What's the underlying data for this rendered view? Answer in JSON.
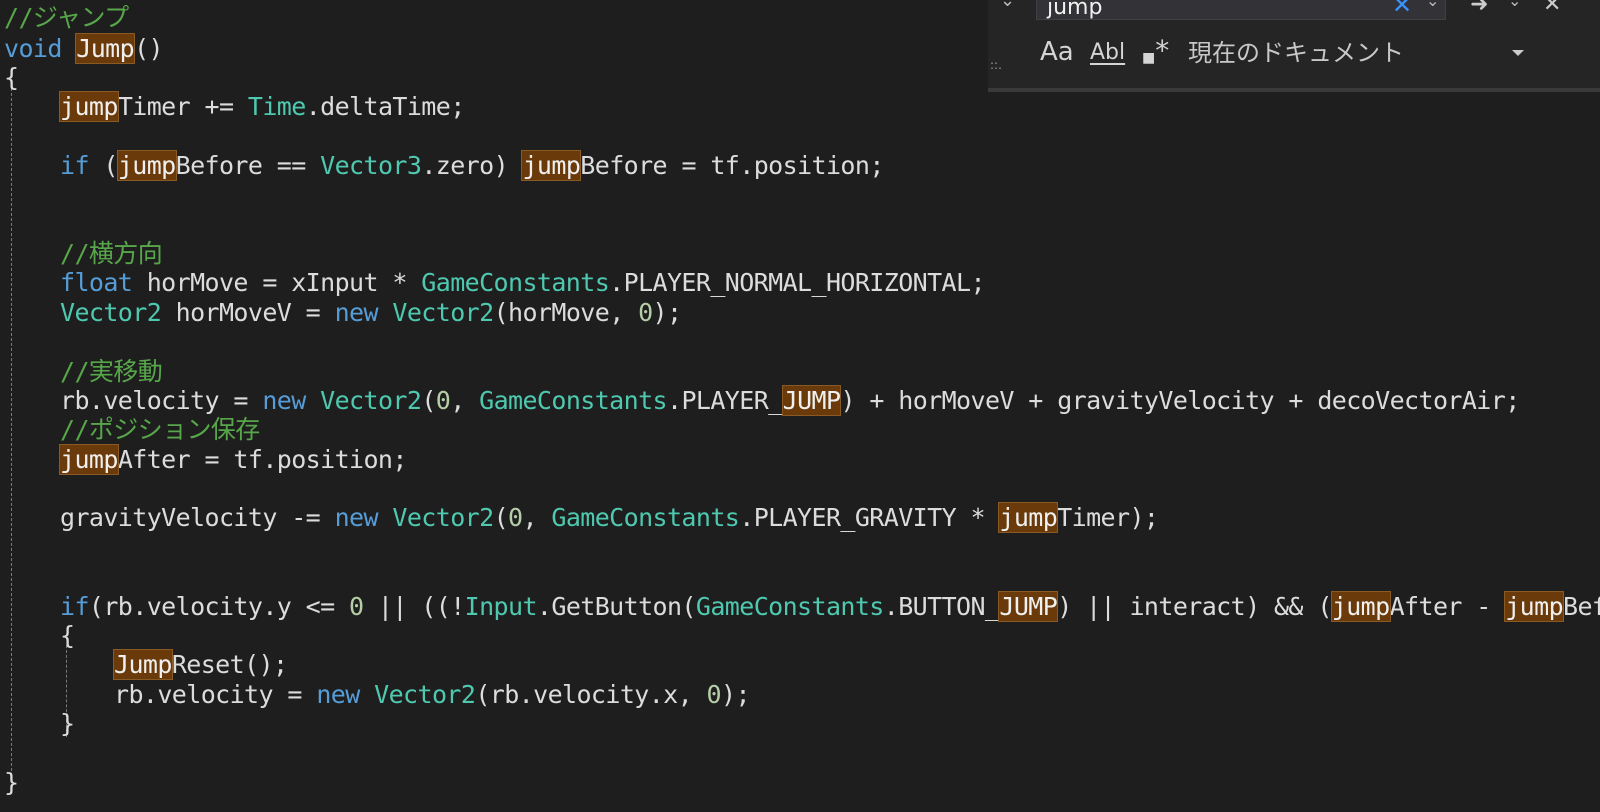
{
  "colors": {
    "background": "#1e1e1e",
    "comment": "#57a64a",
    "keyword": "#569cd6",
    "type": "#4ec9b0",
    "number": "#b5cea8",
    "identifier": "#dcdcdc",
    "highlight": "#6b3a0a"
  },
  "find_widget": {
    "search_value": "jump",
    "match_case_label": "Aa",
    "whole_word_label": "Abl",
    "regex_label": "*",
    "scope_label": "現在のドキュメント",
    "icons": [
      "collapse-chevron-icon",
      "clear-search-icon",
      "find-next-icon",
      "close-icon",
      "match-case-icon",
      "whole-word-icon",
      "regex-icon",
      "dropdown-arrow-icon",
      "resize-grip-icon"
    ]
  },
  "code_lines": [
    {
      "indent": 0,
      "tokens": [
        {
          "t": "//ジャンプ",
          "k": "cm"
        }
      ]
    },
    {
      "indent": 0,
      "tokens": [
        {
          "t": "void",
          "k": "kw"
        },
        {
          "t": " ",
          "k": ""
        },
        {
          "t": "Jump",
          "k": "hl"
        },
        {
          "t": "()",
          "k": ""
        }
      ]
    },
    {
      "indent": 0,
      "tokens": [
        {
          "t": "{",
          "k": ""
        }
      ]
    },
    {
      "indent": 1,
      "tokens": [
        {
          "t": "jump",
          "k": "hl"
        },
        {
          "t": "Timer += ",
          "k": ""
        },
        {
          "t": "Time",
          "k": "ty"
        },
        {
          "t": ".deltaTime;",
          "k": ""
        }
      ]
    },
    {
      "indent": 1,
      "tokens": [
        {
          "t": "if",
          "k": "kw"
        },
        {
          "t": " (",
          "k": ""
        },
        {
          "t": "jump",
          "k": "hl"
        },
        {
          "t": "Before == ",
          "k": ""
        },
        {
          "t": "Vector3",
          "k": "ty"
        },
        {
          "t": ".zero) ",
          "k": ""
        },
        {
          "t": "jump",
          "k": "hl"
        },
        {
          "t": "Before = tf.position;",
          "k": ""
        }
      ]
    },
    {
      "indent": 1,
      "tokens": [
        {
          "t": "//横方向",
          "k": "cm"
        }
      ]
    },
    {
      "indent": 1,
      "tokens": [
        {
          "t": "float",
          "k": "kw"
        },
        {
          "t": " horMove = xInput * ",
          "k": ""
        },
        {
          "t": "GameConstants",
          "k": "ty"
        },
        {
          "t": ".PLAYER_NORMAL_HORIZONTAL;",
          "k": ""
        }
      ]
    },
    {
      "indent": 1,
      "tokens": [
        {
          "t": "Vector2",
          "k": "ty"
        },
        {
          "t": " horMoveV = ",
          "k": ""
        },
        {
          "t": "new",
          "k": "kw"
        },
        {
          "t": " ",
          "k": ""
        },
        {
          "t": "Vector2",
          "k": "ty"
        },
        {
          "t": "(horMove, ",
          "k": ""
        },
        {
          "t": "0",
          "k": "nm"
        },
        {
          "t": ");",
          "k": ""
        }
      ]
    },
    {
      "indent": 1,
      "tokens": [
        {
          "t": "//実移動",
          "k": "cm"
        }
      ]
    },
    {
      "indent": 1,
      "tokens": [
        {
          "t": "rb.velocity = ",
          "k": ""
        },
        {
          "t": "new",
          "k": "kw"
        },
        {
          "t": " ",
          "k": ""
        },
        {
          "t": "Vector2",
          "k": "ty"
        },
        {
          "t": "(",
          "k": ""
        },
        {
          "t": "0",
          "k": "nm"
        },
        {
          "t": ", ",
          "k": ""
        },
        {
          "t": "GameConstants",
          "k": "ty"
        },
        {
          "t": ".PLAYER_",
          "k": ""
        },
        {
          "t": "JUMP",
          "k": "hl"
        },
        {
          "t": ") + horMoveV + gravityVelocity + decoVectorAir;",
          "k": ""
        }
      ]
    },
    {
      "indent": 1,
      "tokens": [
        {
          "t": "//ポジション保存",
          "k": "cm"
        }
      ]
    },
    {
      "indent": 1,
      "tokens": [
        {
          "t": "jump",
          "k": "hl"
        },
        {
          "t": "After = tf.position;",
          "k": ""
        }
      ]
    },
    {
      "indent": 1,
      "tokens": [
        {
          "t": "gravityVelocity -= ",
          "k": ""
        },
        {
          "t": "new",
          "k": "kw"
        },
        {
          "t": " ",
          "k": ""
        },
        {
          "t": "Vector2",
          "k": "ty"
        },
        {
          "t": "(",
          "k": ""
        },
        {
          "t": "0",
          "k": "nm"
        },
        {
          "t": ", ",
          "k": ""
        },
        {
          "t": "GameConstants",
          "k": "ty"
        },
        {
          "t": ".PLAYER_GRAVITY * ",
          "k": ""
        },
        {
          "t": "jump",
          "k": "hl"
        },
        {
          "t": "Timer);",
          "k": ""
        }
      ]
    },
    {
      "indent": 1,
      "tokens": [
        {
          "t": "if",
          "k": "kw"
        },
        {
          "t": "(rb.velocity.y <= ",
          "k": ""
        },
        {
          "t": "0",
          "k": "nm"
        },
        {
          "t": " || ((!",
          "k": ""
        },
        {
          "t": "Input",
          "k": "ty"
        },
        {
          "t": ".GetButton(",
          "k": ""
        },
        {
          "t": "GameConstants",
          "k": "ty"
        },
        {
          "t": ".BUTTON_",
          "k": ""
        },
        {
          "t": "JUMP",
          "k": "hl"
        },
        {
          "t": ") || interact) && (",
          "k": ""
        },
        {
          "t": "jump",
          "k": "hl"
        },
        {
          "t": "After - ",
          "k": ""
        },
        {
          "t": "jump",
          "k": "hl"
        },
        {
          "t": "Before)",
          "k": ""
        }
      ]
    },
    {
      "indent": 1,
      "tokens": [
        {
          "t": "{",
          "k": ""
        }
      ]
    },
    {
      "indent": 2,
      "tokens": [
        {
          "t": "Jump",
          "k": "hl"
        },
        {
          "t": "Reset();",
          "k": ""
        }
      ]
    },
    {
      "indent": 2,
      "tokens": [
        {
          "t": "rb.velocity = ",
          "k": ""
        },
        {
          "t": "new",
          "k": "kw"
        },
        {
          "t": " ",
          "k": ""
        },
        {
          "t": "Vector2",
          "k": "ty"
        },
        {
          "t": "(rb.velocity.x, ",
          "k": ""
        },
        {
          "t": "0",
          "k": "nm"
        },
        {
          "t": ");",
          "k": ""
        }
      ]
    },
    {
      "indent": 1,
      "tokens": [
        {
          "t": "}",
          "k": ""
        }
      ]
    },
    {
      "indent": 0,
      "tokens": [
        {
          "t": "}",
          "k": ""
        }
      ]
    }
  ]
}
